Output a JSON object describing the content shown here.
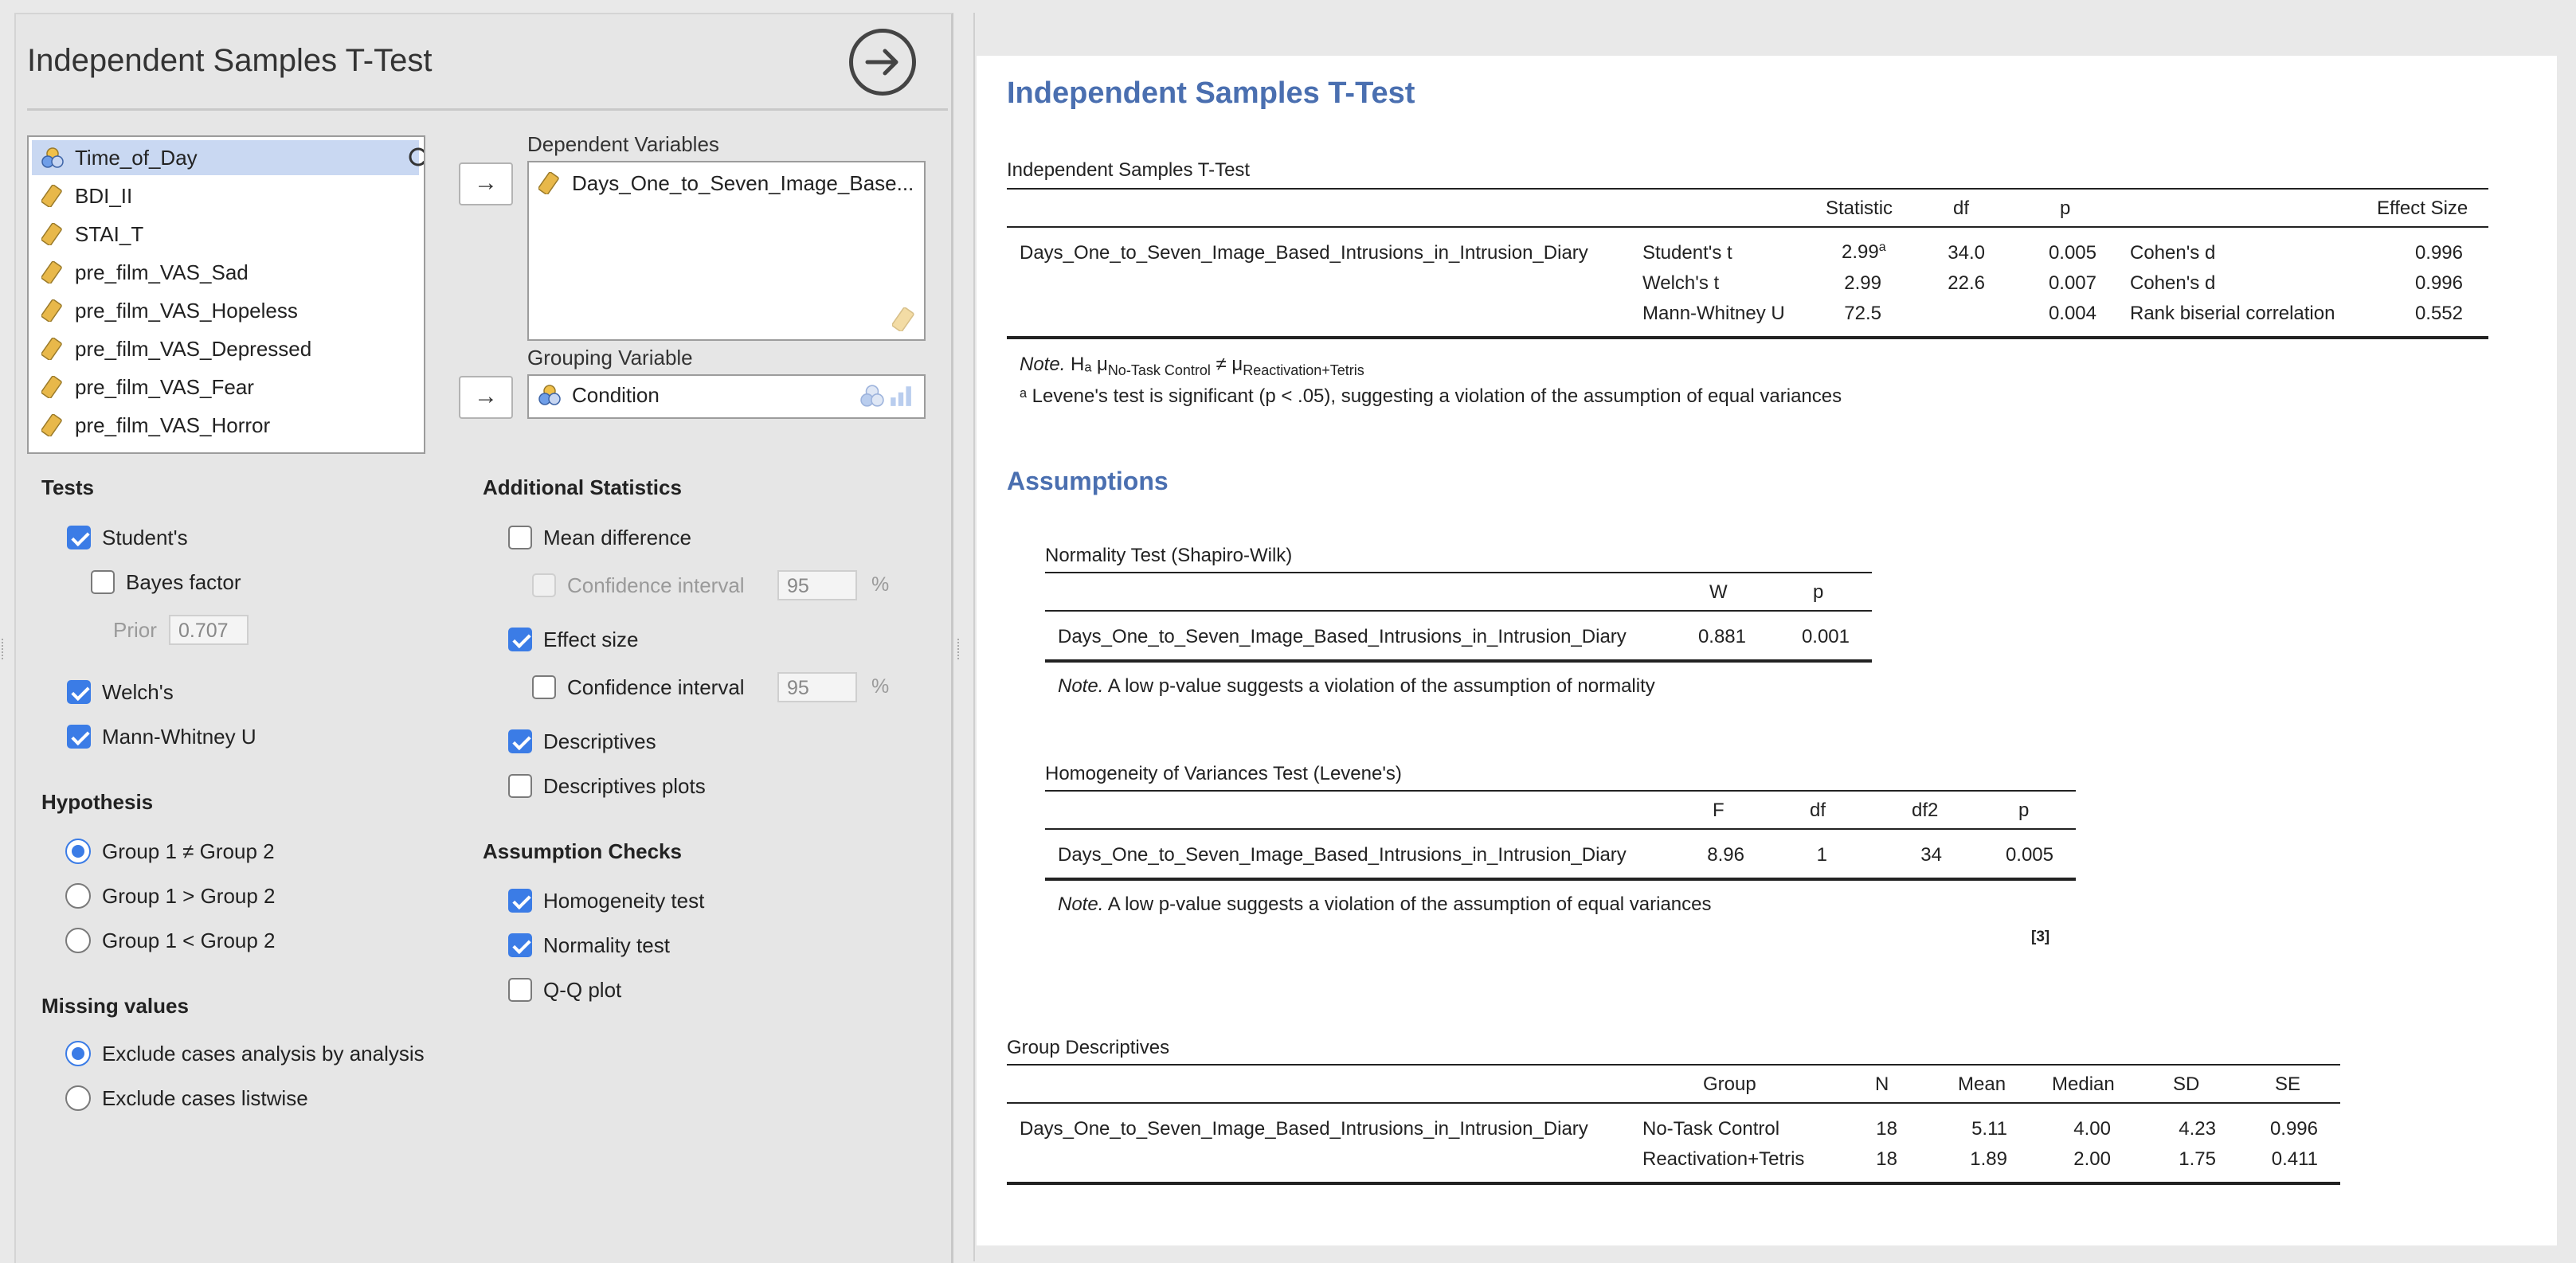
{
  "panel": {
    "title": "Independent Samples T-Test",
    "run_icon": "arrow-right-circle-icon"
  },
  "variables": {
    "items": [
      {
        "label": "Time_of_Day",
        "type": "nominal",
        "icon": "nominal-variable-icon",
        "selected": true
      },
      {
        "label": "BDI_II",
        "type": "scale",
        "icon": "scale-ruler-icon"
      },
      {
        "label": "STAI_T",
        "type": "scale",
        "icon": "scale-ruler-icon"
      },
      {
        "label": "pre_film_VAS_Sad",
        "type": "scale",
        "icon": "scale-ruler-icon"
      },
      {
        "label": "pre_film_VAS_Hopeless",
        "type": "scale",
        "icon": "scale-ruler-icon"
      },
      {
        "label": "pre_film_VAS_Depressed",
        "type": "scale",
        "icon": "scale-ruler-icon"
      },
      {
        "label": "pre_film_VAS_Fear",
        "type": "scale",
        "icon": "scale-ruler-icon"
      },
      {
        "label": "pre_film_VAS_Horror",
        "type": "scale",
        "icon": "scale-ruler-icon"
      }
    ]
  },
  "dependent": {
    "label": "Dependent Variables",
    "value": "Days_One_to_Seven_Image_Base..."
  },
  "grouping": {
    "label": "Grouping Variable",
    "value": "Condition"
  },
  "tests": {
    "heading": "Tests",
    "students": {
      "label": "Student's",
      "checked": true
    },
    "bayes": {
      "label": "Bayes factor",
      "checked": false
    },
    "prior": {
      "label": "Prior",
      "value": "0.707"
    },
    "welch": {
      "label": "Welch's",
      "checked": true
    },
    "mann_whitney": {
      "label": "Mann-Whitney U",
      "checked": true
    }
  },
  "hypothesis": {
    "heading": "Hypothesis",
    "options": [
      {
        "label": "Group 1 ≠ Group 2",
        "selected": true
      },
      {
        "label": "Group 1 > Group 2",
        "selected": false
      },
      {
        "label": "Group 1 < Group 2",
        "selected": false
      }
    ]
  },
  "missing": {
    "heading": "Missing values",
    "options": [
      {
        "label": "Exclude cases analysis by analysis",
        "selected": true
      },
      {
        "label": "Exclude cases listwise",
        "selected": false
      }
    ]
  },
  "additional": {
    "heading": "Additional Statistics",
    "mean_difference": {
      "label": "Mean difference",
      "checked": false
    },
    "ci1": {
      "label": "Confidence interval",
      "value": "95",
      "unit": "%",
      "enabled": false
    },
    "effect_size": {
      "label": "Effect size",
      "checked": true
    },
    "ci2": {
      "label": "Confidence interval",
      "value": "95",
      "unit": "%",
      "checked": false
    },
    "descriptives": {
      "label": "Descriptives",
      "checked": true
    },
    "descriptives_plots": {
      "label": "Descriptives plots",
      "checked": false
    }
  },
  "assumption_checks": {
    "heading": "Assumption Checks",
    "homogeneity": {
      "label": "Homogeneity test",
      "checked": true
    },
    "normality": {
      "label": "Normality test",
      "checked": true
    },
    "qq": {
      "label": "Q-Q plot",
      "checked": false
    }
  },
  "results": {
    "heading": "Independent Samples T-Test",
    "ttest": {
      "title": "Independent Samples T-Test",
      "headers": {
        "statistic": "Statistic",
        "df": "df",
        "p": "p",
        "effect_size": "Effect Size"
      },
      "variable": "Days_One_to_Seven_Image_Based_Intrusions_in_Intrusion_Diary",
      "rows": [
        {
          "test": "Student's t",
          "statistic": "2.99",
          "mark": "a",
          "df": "34.0",
          "p": "0.005",
          "es_name": "Cohen's d",
          "es": "0.996"
        },
        {
          "test": "Welch's t",
          "statistic": "2.99",
          "mark": "",
          "df": "22.6",
          "p": "0.007",
          "es_name": "Cohen's d",
          "es": "0.996"
        },
        {
          "test": "Mann-Whitney U",
          "statistic": "72.5",
          "mark": "",
          "df": "",
          "p": "0.004",
          "es_name": "Rank biserial correlation",
          "es": "0.552"
        }
      ],
      "note_prefix": "Note.",
      "note_h": "Hₐ μ",
      "note_sub1": "No-Task Control",
      "note_neq": " ≠ μ",
      "note_sub2": "Reactivation+Tetris",
      "footnote": "ᵃ Levene's test is significant (p < .05), suggesting a violation of the assumption of equal variances"
    },
    "assumptions_heading": "Assumptions",
    "normality": {
      "title": "Normality Test (Shapiro-Wilk)",
      "headers": {
        "w": "W",
        "p": "p"
      },
      "variable": "Days_One_to_Seven_Image_Based_Intrusions_in_Intrusion_Diary",
      "w": "0.881",
      "p": "0.001",
      "note_prefix": "Note.",
      "note": "A low p-value suggests a violation of the assumption of normality"
    },
    "levene": {
      "title": "Homogeneity of Variances Test (Levene's)",
      "headers": {
        "f": "F",
        "df": "df",
        "df2": "df2",
        "p": "p"
      },
      "variable": "Days_One_to_Seven_Image_Based_Intrusions_in_Intrusion_Diary",
      "f": "8.96",
      "df": "1",
      "df2": "34",
      "p": "0.005",
      "note_prefix": "Note.",
      "note": "A low p-value suggests a violation of the assumption of equal variances",
      "ref": "[3]"
    },
    "descriptives": {
      "title": "Group Descriptives",
      "headers": {
        "group": "Group",
        "n": "N",
        "mean": "Mean",
        "median": "Median",
        "sd": "SD",
        "se": "SE"
      },
      "variable": "Days_One_to_Seven_Image_Based_Intrusions_in_Intrusion_Diary",
      "rows": [
        {
          "group": "No-Task Control",
          "n": "18",
          "mean": "5.11",
          "median": "4.00",
          "sd": "4.23",
          "se": "0.996"
        },
        {
          "group": "Reactivation+Tetris",
          "n": "18",
          "mean": "1.89",
          "median": "2.00",
          "sd": "1.75",
          "se": "0.411"
        }
      ]
    }
  }
}
